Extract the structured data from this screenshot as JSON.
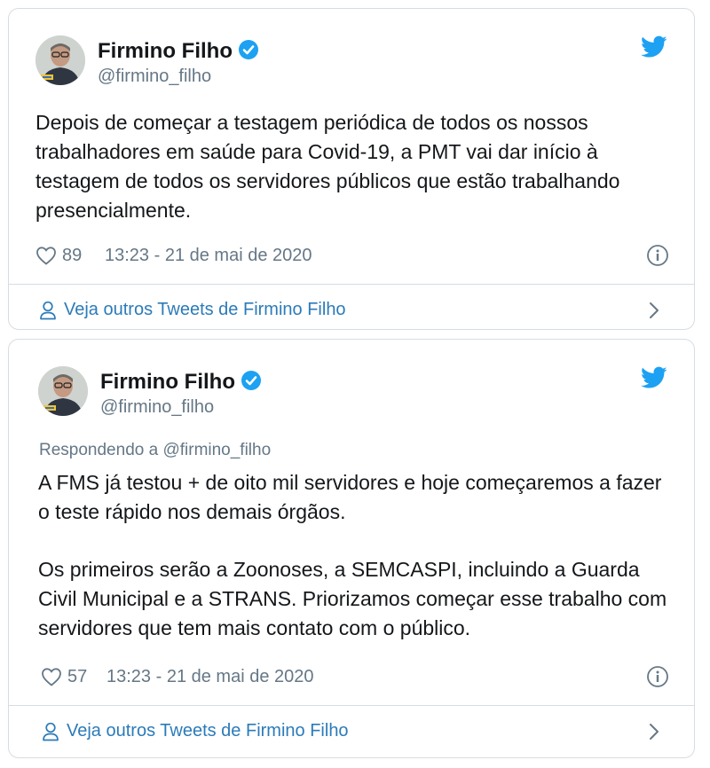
{
  "tweets": [
    {
      "author": "Firmino Filho",
      "handle": "@firmino_filho",
      "replying": "",
      "text": "Depois de começar a testagem periódica de todos os nossos trabalhadores em saúde para Covid-19, a PMT vai dar início à testagem de todos os servidores públicos que estão trabalhando presencialmente.",
      "likes": "89",
      "timestamp": "13:23 - 21 de mai de 2020",
      "footer": "Veja outros Tweets de Firmino Filho"
    },
    {
      "author": "Firmino Filho",
      "handle": "@firmino_filho",
      "replying": "Respondendo a @firmino_filho",
      "text_p1": "A FMS já testou + de oito mil servidores e hoje começaremos a fazer o teste rápido nos demais órgãos.",
      "text_p2": "Os primeiros serão a Zoonoses, a SEMCASPI, incluindo a Guarda Civil Municipal e a STRANS. Priorizamos começar esse trabalho com servidores que tem mais contato com o público.",
      "likes": "57",
      "timestamp": "13:23 - 21 de mai de 2020",
      "footer": "Veja outros Tweets de Firmino Filho"
    }
  ],
  "colors": {
    "text": "#14171a",
    "secondary": "#657786",
    "link": "#2b7bb9",
    "twitter_blue": "#1da1f2",
    "border": "#d5dde3"
  },
  "icons": [
    "verified-icon",
    "twitter-bird-icon",
    "heart-icon",
    "info-icon",
    "person-icon",
    "chevron-right-icon"
  ]
}
